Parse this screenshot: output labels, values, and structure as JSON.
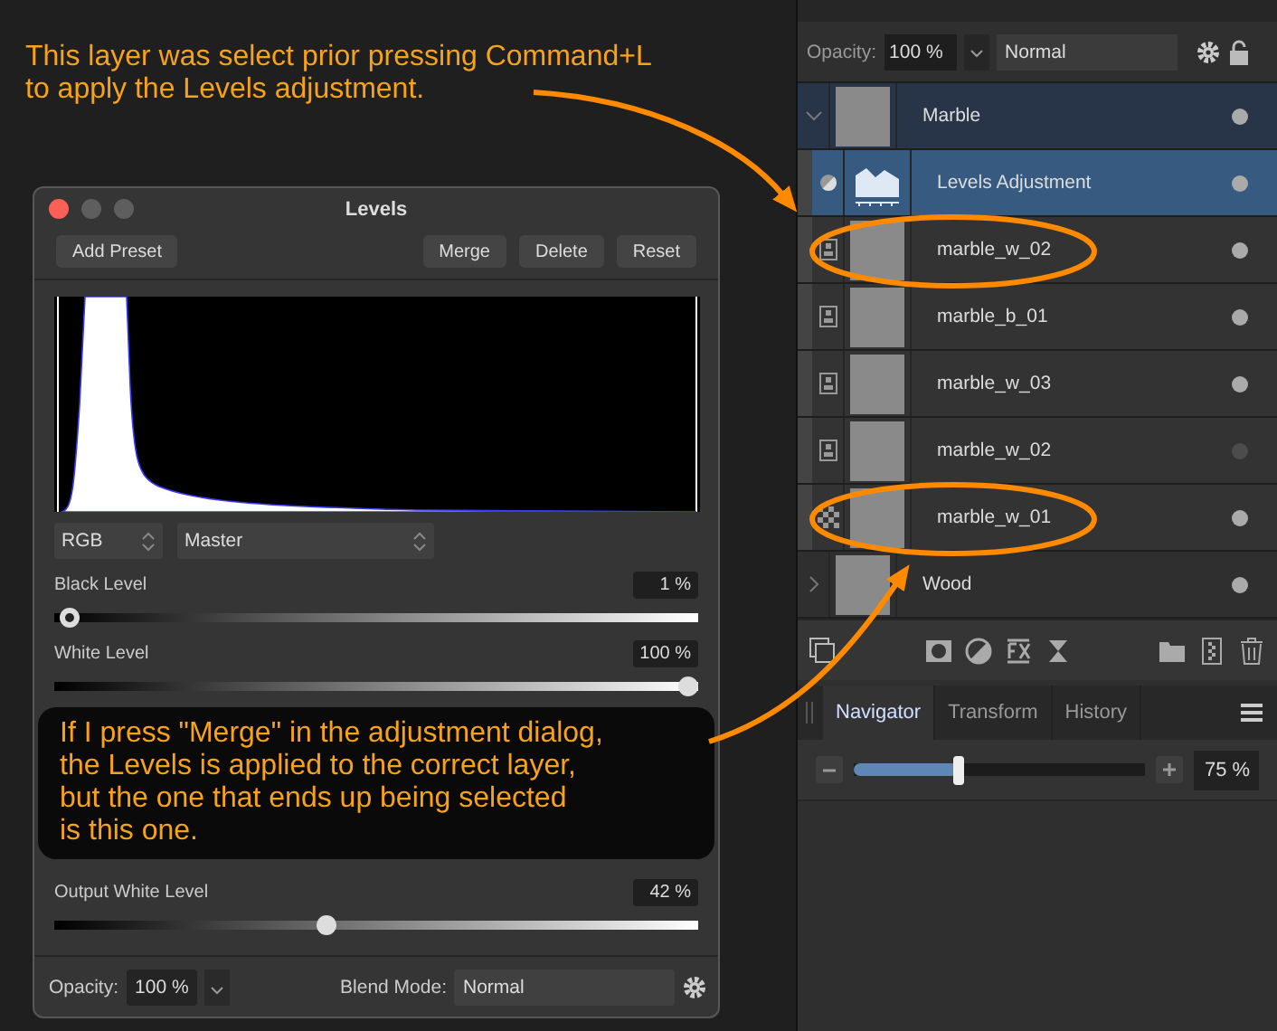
{
  "annotations": [
    {
      "lines": [
        "This layer was select prior pressing Command+L",
        "to apply the Levels adjustment."
      ]
    },
    {
      "lines": [
        "If I press \"Merge\" in the adjustment dialog,",
        "the Levels is applied to the correct layer,",
        "but the one that ends up being selected",
        "is this one."
      ]
    }
  ],
  "levels_dialog": {
    "title": "Levels",
    "buttons": [
      {
        "label": "Add Preset",
        "kind": "left"
      },
      {
        "label": "Merge",
        "kind": "right"
      },
      {
        "label": "Delete",
        "kind": "right"
      },
      {
        "label": "Reset",
        "kind": "right"
      }
    ],
    "channel": "RGB",
    "mode": "Master",
    "sliders": [
      {
        "label": "Black Level",
        "value": "1 %",
        "level": 0.01
      },
      {
        "label": "White Level",
        "value": "100 %",
        "level": 1
      },
      {
        "label": "Output White Level",
        "value": "42 %",
        "level": 0.42
      }
    ],
    "footer": {
      "opacity_label": "Opacity:",
      "opacity": "100 %",
      "blend_label": "Blend Mode:",
      "blend_mode": "Normal"
    }
  },
  "layers_panel": {
    "opacity_label": "Opacity:",
    "opacity": "100 %",
    "blend_mode": "Normal",
    "layers": [
      {
        "name": "Marble",
        "kind": "group",
        "expanded": true,
        "selected": true,
        "visible": true,
        "children": [
          {
            "name": "Levels Adjustment",
            "kind": "adjustment",
            "selected": true,
            "visible": true
          },
          {
            "name": "marble_w_02",
            "kind": "pixel",
            "selected": false,
            "visible": true
          },
          {
            "name": "marble_b_01",
            "kind": "pixel",
            "selected": false,
            "visible": true
          },
          {
            "name": "marble_w_03",
            "kind": "pixel",
            "selected": false,
            "visible": true
          },
          {
            "name": "marble_w_02",
            "kind": "pixel",
            "selected": false,
            "visible": false
          },
          {
            "name": "marble_w_01",
            "kind": "image",
            "selected": false,
            "visible": true
          }
        ]
      },
      {
        "name": "Wood",
        "kind": "group",
        "expanded": false,
        "selected": false,
        "visible": true
      }
    ]
  },
  "navigator": {
    "tabs": [
      {
        "label": "Navigator",
        "selected": true
      },
      {
        "label": "Transform",
        "selected": false
      },
      {
        "label": "History",
        "selected": false
      }
    ],
    "zoom": {
      "level": 0.36,
      "value": "75 %"
    }
  }
}
